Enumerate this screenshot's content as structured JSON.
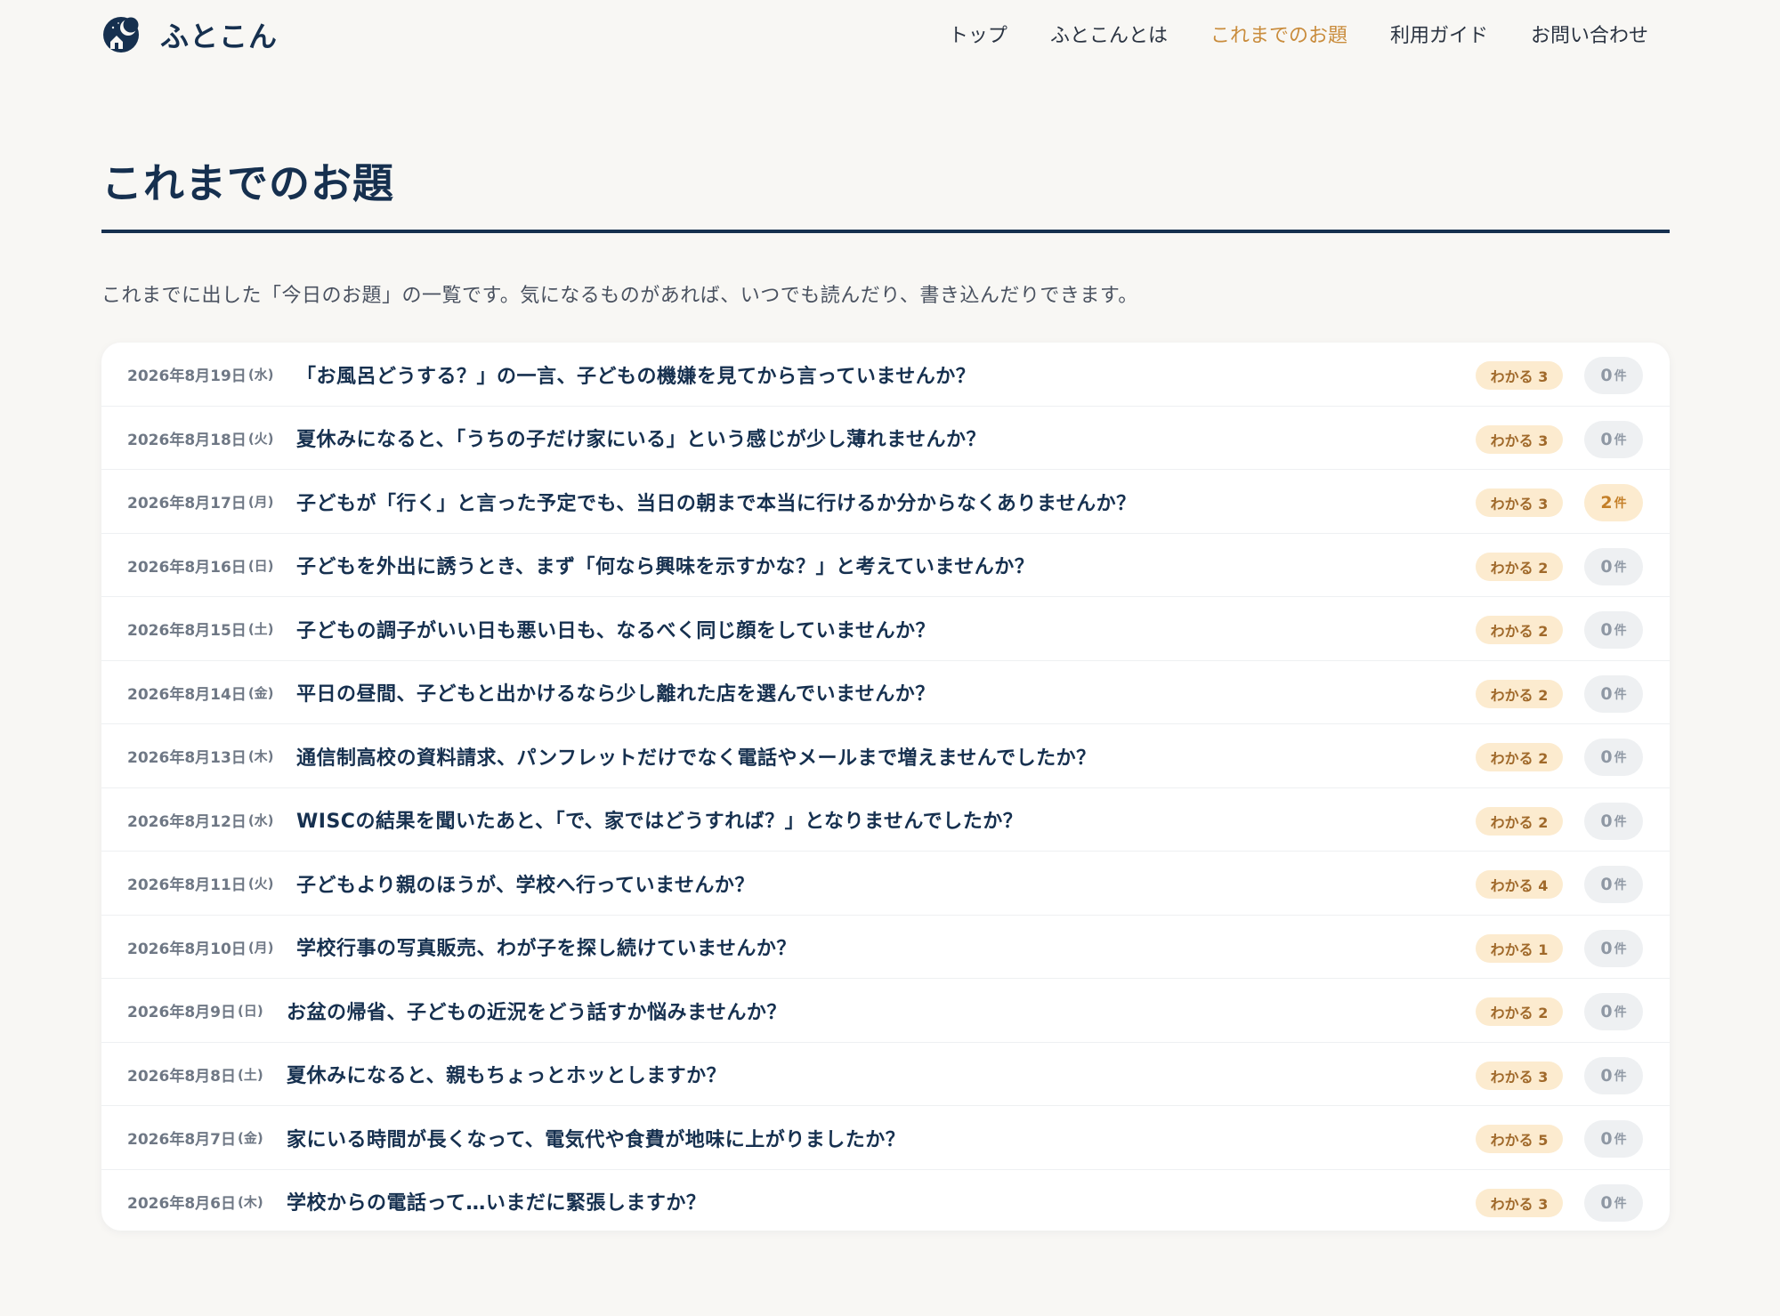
{
  "header": {
    "logo_text": "ふとこん",
    "logo_icon": "moon-house-icon",
    "nav": [
      {
        "label": "トップ",
        "active": false
      },
      {
        "label": "ふとこんとは",
        "active": false
      },
      {
        "label": "これまでのお題",
        "active": true
      },
      {
        "label": "利用ガイド",
        "active": false
      },
      {
        "label": "お問い合わせ",
        "active": false
      }
    ]
  },
  "page": {
    "title": "これまでのお題",
    "intro": "これまでに出した「今日のお題」の一覧です。気になるものがあれば、いつでも読んだり、書き込んだりできます。"
  },
  "colors": {
    "navy": "#16304f",
    "accent": "#c98c3c",
    "badge_bg": "#fcebcf",
    "count_bg": "#eef0f2"
  },
  "topics": [
    {
      "date": "2026年8月19日",
      "weekday": "(水)",
      "title": "「お風呂どうする？」の一言、子どもの機嫌を見てから言っていませんか？",
      "wakaru": "わかる 3",
      "count": "0",
      "unit": "件"
    },
    {
      "date": "2026年8月18日",
      "weekday": "(火)",
      "title": "夏休みになると、「うちの子だけ家にいる」という感じが少し薄れませんか？",
      "wakaru": "わかる 3",
      "count": "0",
      "unit": "件"
    },
    {
      "date": "2026年8月17日",
      "weekday": "(月)",
      "title": "子どもが「行く」と言った予定でも、当日の朝まで本当に行けるか分からなくありませんか？",
      "wakaru": "わかる 3",
      "count": "2",
      "unit": "件"
    },
    {
      "date": "2026年8月16日",
      "weekday": "(日)",
      "title": "子どもを外出に誘うとき、まず「何なら興味を示すかな？」と考えていませんか？",
      "wakaru": "わかる 2",
      "count": "0",
      "unit": "件"
    },
    {
      "date": "2026年8月15日",
      "weekday": "(土)",
      "title": "子どもの調子がいい日も悪い日も、なるべく同じ顔をしていませんか？",
      "wakaru": "わかる 2",
      "count": "0",
      "unit": "件"
    },
    {
      "date": "2026年8月14日",
      "weekday": "(金)",
      "title": "平日の昼間、子どもと出かけるなら少し離れた店を選んでいませんか？",
      "wakaru": "わかる 2",
      "count": "0",
      "unit": "件"
    },
    {
      "date": "2026年8月13日",
      "weekday": "(木)",
      "title": "通信制高校の資料請求、パンフレットだけでなく電話やメールまで増えませんでしたか？",
      "wakaru": "わかる 2",
      "count": "0",
      "unit": "件"
    },
    {
      "date": "2026年8月12日",
      "weekday": "(水)",
      "title": "WISCの結果を聞いたあと、「で、家ではどうすれば？」となりませんでしたか？",
      "wakaru": "わかる 2",
      "count": "0",
      "unit": "件"
    },
    {
      "date": "2026年8月11日",
      "weekday": "(火)",
      "title": "子どもより親のほうが、学校へ行っていませんか？",
      "wakaru": "わかる 4",
      "count": "0",
      "unit": "件"
    },
    {
      "date": "2026年8月10日",
      "weekday": "(月)",
      "title": "学校行事の写真販売、わが子を探し続けていませんか？",
      "wakaru": "わかる 1",
      "count": "0",
      "unit": "件"
    },
    {
      "date": "2026年8月9日",
      "weekday": "(日)",
      "title": "お盆の帰省、子どもの近況をどう話すか悩みませんか？",
      "wakaru": "わかる 2",
      "count": "0",
      "unit": "件"
    },
    {
      "date": "2026年8月8日",
      "weekday": "(土)",
      "title": "夏休みになると、親もちょっとホッとしますか？",
      "wakaru": "わかる 3",
      "count": "0",
      "unit": "件"
    },
    {
      "date": "2026年8月7日",
      "weekday": "(金)",
      "title": "家にいる時間が長くなって、電気代や食費が地味に上がりましたか？",
      "wakaru": "わかる 5",
      "count": "0",
      "unit": "件"
    },
    {
      "date": "2026年8月6日",
      "weekday": "(木)",
      "title": "学校からの電話って…いまだに緊張しますか？",
      "wakaru": "わかる 3",
      "count": "0",
      "unit": "件"
    }
  ]
}
